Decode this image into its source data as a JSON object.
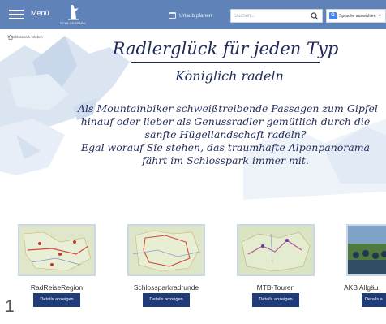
{
  "header": {
    "menu_label": "Menü",
    "logo_text": "SCHLOSSPARK",
    "plan_link": "Urlaub planen",
    "search_placeholder": "Suchen...",
    "language_label": "Sprache auswählen",
    "language_sep": "▼",
    "google_letter": "G"
  },
  "breadcrumb": {
    "current": "Schlosspark erleben"
  },
  "hero": {
    "title": "Radlerglück für jeden Typ",
    "subtitle": "Königlich radeln",
    "body_lines": [
      "Als Mountainbiker schweißtreibende Passagen zum Gipfel",
      "hinauf oder lieber als Genussradler gemütlich durch die",
      "sanfte Hügellandschaft radeln?",
      "Egal worauf Sie stehen, das traumhafte Alpenpanorama",
      "fährt im Schlosspark immer mit."
    ]
  },
  "cards": [
    {
      "title": "RadReiseRegion",
      "button": "Details anzeigen"
    },
    {
      "title": "Schlossparkradrunde",
      "button": "Details anzeigen"
    },
    {
      "title": "MTB-Touren",
      "button": "Details anzeigen"
    },
    {
      "title": "AKB Allgäu",
      "button": "Details a"
    }
  ],
  "page_number": "1",
  "colors": {
    "header_bg": "#5f82b8",
    "button_bg": "#1f3c78",
    "text_navy": "#1f2a5a"
  }
}
